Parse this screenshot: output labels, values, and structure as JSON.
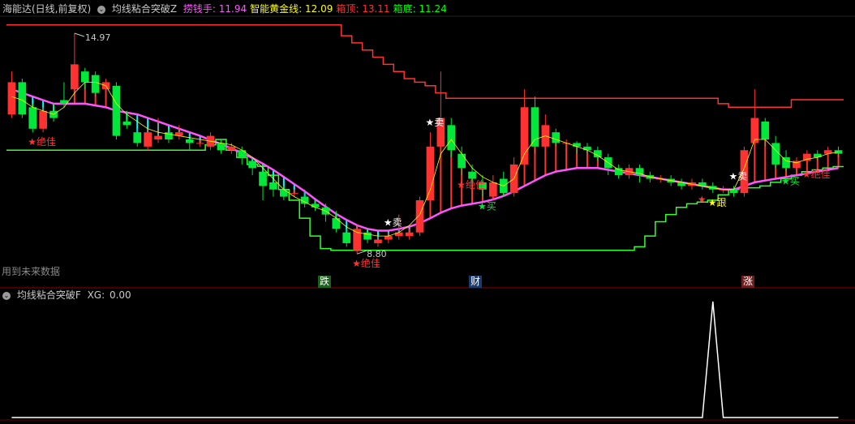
{
  "header": {
    "stock_title": "海能达(日线,前复权)",
    "indicator_name": "均线粘合突破Z",
    "items": [
      {
        "label": "捞钱手:",
        "value": "11.94",
        "color": "#ff55ff"
      },
      {
        "label": "智能黄金线:",
        "value": "12.09",
        "color": "#ffff00"
      },
      {
        "label": "箱顶:",
        "value": "13.11",
        "color": "#ff3333"
      },
      {
        "label": "箱底:",
        "value": "11.24",
        "color": "#00ff00"
      }
    ]
  },
  "future_note": "用到未来数据",
  "event_labels": [
    {
      "text": "跌",
      "bg": "#1f5f1f"
    },
    {
      "text": "财",
      "bg": "#1d3a6a"
    },
    {
      "text": "涨",
      "bg": "#6a1f1f"
    }
  ],
  "sub_header": {
    "indicator_name": "均线粘合突破F",
    "xg_label": "XG:",
    "xg_value": "0.00"
  },
  "chart_data": {
    "type": "candlestick",
    "price_high_label": "14.97",
    "price_low_label": "8.80",
    "colors": {
      "up": "#ff3232",
      "down": "#00e83a",
      "band": "#ff55ff",
      "fill": "#00ffff",
      "box_top": "#ff3333",
      "box_bottom": "#33ff33",
      "ma": "#ffff00"
    },
    "candles": [
      [
        12.7,
        13.6,
        13.9,
        12.6
      ],
      [
        13.6,
        12.7,
        13.7,
        12.6
      ],
      [
        12.9,
        12.3,
        13.0,
        12.2
      ],
      [
        12.3,
        12.8,
        12.9,
        12.2
      ],
      [
        12.8,
        12.6,
        13.0,
        12.5
      ],
      [
        13.1,
        13.0,
        13.6,
        12.9
      ],
      [
        13.4,
        14.1,
        14.97,
        13.3
      ],
      [
        13.9,
        13.6,
        14.0,
        13.4
      ],
      [
        13.8,
        13.3,
        13.9,
        13.2
      ],
      [
        13.4,
        13.6,
        13.7,
        13.2
      ],
      [
        13.5,
        12.1,
        13.6,
        12.0
      ],
      [
        12.5,
        12.4,
        12.8,
        12.3
      ],
      [
        12.2,
        11.9,
        12.3,
        11.8
      ],
      [
        11.8,
        12.2,
        12.3,
        11.7
      ],
      [
        12.0,
        12.1,
        12.6,
        11.9
      ],
      [
        12.2,
        12.0,
        12.3,
        11.9
      ],
      [
        12.1,
        12.2,
        12.4,
        12.0
      ],
      [
        12.0,
        11.9,
        12.1,
        11.7
      ],
      [
        11.9,
        11.9,
        12.0,
        11.8
      ],
      [
        11.8,
        12.1,
        12.2,
        11.7
      ],
      [
        11.9,
        11.7,
        12.0,
        11.6
      ],
      [
        11.7,
        11.8,
        11.9,
        11.6
      ],
      [
        11.7,
        11.5,
        11.8,
        11.3
      ],
      [
        11.4,
        11.2,
        11.5,
        11.0
      ],
      [
        11.1,
        10.7,
        11.3,
        10.3
      ],
      [
        10.8,
        10.6,
        10.9,
        10.4
      ],
      [
        10.6,
        10.4,
        10.7,
        10.3
      ],
      [
        10.5,
        10.5,
        10.6,
        10.4
      ],
      [
        10.4,
        10.2,
        10.6,
        10.1
      ],
      [
        10.2,
        10.1,
        10.3,
        10.0
      ],
      [
        10.1,
        9.9,
        10.2,
        9.7
      ],
      [
        9.8,
        9.5,
        10.0,
        9.4
      ],
      [
        9.4,
        9.1,
        9.5,
        9.0
      ],
      [
        8.9,
        9.5,
        9.6,
        8.8
      ],
      [
        9.4,
        9.2,
        9.5,
        9.1
      ],
      [
        9.1,
        9.2,
        9.3,
        9.0
      ],
      [
        9.2,
        9.3,
        9.4,
        9.1
      ],
      [
        9.3,
        9.4,
        9.9,
        9.2
      ],
      [
        9.3,
        9.4,
        9.5,
        9.2
      ],
      [
        9.4,
        10.3,
        10.4,
        9.3
      ],
      [
        10.3,
        11.8,
        12.2,
        10.2
      ],
      [
        11.8,
        12.6,
        13.9,
        11.6
      ],
      [
        12.4,
        11.7,
        12.6,
        11.5
      ],
      [
        11.6,
        11.2,
        11.8,
        11.0
      ],
      [
        11.1,
        10.9,
        11.3,
        10.7
      ],
      [
        10.8,
        10.6,
        11.0,
        10.4
      ],
      [
        10.4,
        10.8,
        11.0,
        10.3
      ],
      [
        10.9,
        10.5,
        11.1,
        10.4
      ],
      [
        10.5,
        11.3,
        11.5,
        10.4
      ],
      [
        11.3,
        12.9,
        13.4,
        11.2
      ],
      [
        12.9,
        11.8,
        13.2,
        11.6
      ],
      [
        11.8,
        12.4,
        12.7,
        11.7
      ],
      [
        12.2,
        11.9,
        12.3,
        11.8
      ],
      [
        11.9,
        11.9,
        12.0,
        11.7
      ],
      [
        11.9,
        11.8,
        11.95,
        11.6
      ],
      [
        11.8,
        11.7,
        11.9,
        11.6
      ],
      [
        11.7,
        11.5,
        11.8,
        11.4
      ],
      [
        11.5,
        11.2,
        11.6,
        11.0
      ],
      [
        11.2,
        11.0,
        11.3,
        10.9
      ],
      [
        11.0,
        11.2,
        11.3,
        10.9
      ],
      [
        11.2,
        11.0,
        11.3,
        10.8
      ],
      [
        11.0,
        10.9,
        11.1,
        10.8
      ],
      [
        10.9,
        10.9,
        11.0,
        10.8
      ],
      [
        10.9,
        10.8,
        11.0,
        10.7
      ],
      [
        10.8,
        10.7,
        10.9,
        10.6
      ],
      [
        10.7,
        10.8,
        10.9,
        10.6
      ],
      [
        10.8,
        10.7,
        10.9,
        10.6
      ],
      [
        10.7,
        10.6,
        10.8,
        10.5
      ],
      [
        10.6,
        10.6,
        10.7,
        10.5
      ],
      [
        10.6,
        10.5,
        10.7,
        10.4
      ],
      [
        10.5,
        11.7,
        11.8,
        10.4
      ],
      [
        11.9,
        12.6,
        13.4,
        11.8
      ],
      [
        12.5,
        12.0,
        12.6,
        11.8
      ],
      [
        11.9,
        11.3,
        12.1,
        11.2
      ],
      [
        11.5,
        11.2,
        11.7,
        11.1
      ],
      [
        11.2,
        11.4,
        11.5,
        11.1
      ],
      [
        11.4,
        11.6,
        11.7,
        11.3
      ],
      [
        11.6,
        11.5,
        11.7,
        11.4
      ],
      [
        11.6,
        11.7,
        11.8,
        11.5
      ],
      [
        11.7,
        11.6,
        11.8,
        11.5
      ]
    ],
    "band": [
      13.4,
      13.3,
      13.2,
      13.1,
      13.0,
      13.0,
      13.0,
      13.0,
      12.95,
      12.9,
      12.8,
      12.75,
      12.7,
      12.6,
      12.5,
      12.4,
      12.3,
      12.2,
      12.1,
      11.98,
      11.87,
      11.75,
      11.62,
      11.48,
      11.32,
      11.15,
      10.95,
      10.75,
      10.55,
      10.33,
      10.12,
      9.92,
      9.75,
      9.6,
      9.5,
      9.45,
      9.45,
      9.5,
      9.56,
      9.66,
      9.8,
      9.95,
      10.07,
      10.15,
      10.2,
      10.25,
      10.32,
      10.42,
      10.55,
      10.7,
      10.85,
      11.0,
      11.1,
      11.15,
      11.2,
      11.2,
      11.2,
      11.15,
      11.1,
      11.05,
      11.0,
      10.95,
      10.9,
      10.85,
      10.8,
      10.75,
      10.7,
      10.65,
      10.6,
      10.6,
      10.7,
      10.8,
      10.85,
      10.9,
      10.95,
      11.0,
      11.05,
      11.1,
      11.15,
      11.2
    ],
    "box_top": [
      15.2,
      15.2,
      15.2,
      15.2,
      15.2,
      15.2,
      15.2,
      15.2,
      15.2,
      15.2,
      15.2,
      15.2,
      15.2,
      15.2,
      15.2,
      15.2,
      15.2,
      15.2,
      15.2,
      15.2,
      15.2,
      15.2,
      15.2,
      15.2,
      15.2,
      15.2,
      15.2,
      15.2,
      15.2,
      15.2,
      15.2,
      15.2,
      14.9,
      14.7,
      14.5,
      14.3,
      14.1,
      13.9,
      13.7,
      13.6,
      13.5,
      13.3,
      13.15,
      13.15,
      13.15,
      13.15,
      13.15,
      13.15,
      13.15,
      13.15,
      13.15,
      13.15,
      13.15,
      13.15,
      13.15,
      13.15,
      13.15,
      13.15,
      13.15,
      13.15,
      13.15,
      13.15,
      13.15,
      13.15,
      13.15,
      13.15,
      13.15,
      13.15,
      13.0,
      12.9,
      12.9,
      12.9,
      12.9,
      12.9,
      12.9,
      13.11,
      13.11,
      13.11,
      13.11,
      13.11
    ],
    "box_bottom": [
      11.7,
      11.7,
      11.7,
      11.7,
      11.7,
      11.7,
      11.7,
      11.7,
      11.7,
      11.7,
      11.7,
      11.7,
      11.7,
      11.7,
      11.7,
      11.7,
      11.7,
      11.7,
      11.7,
      11.85,
      12.0,
      11.7,
      11.5,
      11.3,
      11.25,
      11.0,
      10.6,
      10.3,
      9.8,
      9.3,
      8.95,
      8.9,
      8.9,
      8.9,
      8.9,
      8.9,
      8.9,
      8.9,
      8.9,
      8.9,
      8.9,
      8.9,
      8.9,
      8.9,
      8.9,
      8.9,
      8.9,
      8.9,
      8.9,
      8.9,
      8.9,
      8.9,
      8.9,
      8.9,
      8.9,
      8.9,
      8.9,
      8.9,
      8.9,
      8.9,
      9.0,
      9.3,
      9.7,
      9.9,
      10.1,
      10.2,
      10.25,
      10.3,
      10.45,
      10.6,
      10.65,
      10.65,
      10.7,
      10.8,
      10.9,
      11.0,
      11.1,
      11.15,
      11.2,
      11.24
    ],
    "ma": [
      13.2,
      13.1,
      12.9,
      12.8,
      12.7,
      12.9,
      13.3,
      13.6,
      13.6,
      13.5,
      13.0,
      12.7,
      12.5,
      12.3,
      12.2,
      12.15,
      12.1,
      12.05,
      12.0,
      11.95,
      11.9,
      11.85,
      11.7,
      11.5,
      11.2,
      10.9,
      10.6,
      10.4,
      10.25,
      10.1,
      10.0,
      9.8,
      9.55,
      9.4,
      9.35,
      9.3,
      9.3,
      9.4,
      9.6,
      9.9,
      10.6,
      11.6,
      12.0,
      11.6,
      11.2,
      10.95,
      10.8,
      10.7,
      10.9,
      11.6,
      12.0,
      12.1,
      12.0,
      11.9,
      11.8,
      11.7,
      11.55,
      11.35,
      11.15,
      11.1,
      11.05,
      10.95,
      10.9,
      10.85,
      10.8,
      10.75,
      10.7,
      10.65,
      10.6,
      10.6,
      11.2,
      12.0,
      12.0,
      11.7,
      11.4,
      11.35,
      11.45,
      11.5,
      11.6,
      11.65
    ],
    "signals": [
      {
        "i": 2,
        "text": "★绝佳",
        "pos": "below",
        "color": "#ff3333"
      },
      {
        "i": 36,
        "text": "★卖",
        "pos": "above",
        "color": "#ffffff"
      },
      {
        "i": 40,
        "text": "★卖",
        "pos": "above",
        "color": "#ffffff"
      },
      {
        "i": 69,
        "text": "★卖",
        "pos": "above",
        "color": "#ffffff"
      },
      {
        "i": 43,
        "text": "★绝佳",
        "pos": "below",
        "color": "#ff3333"
      },
      {
        "i": 45,
        "text": "★买",
        "pos": "below",
        "color": "#00e83a"
      },
      {
        "i": 74,
        "text": "★买",
        "pos": "below",
        "color": "#00e83a"
      },
      {
        "i": 76,
        "text": "★绝佳",
        "pos": "below",
        "color": "#ff3333"
      },
      {
        "i": 33,
        "text": "★绝佳",
        "pos": "below",
        "color": "#ff3333"
      },
      {
        "i": 66,
        "text": "★",
        "pos": "below",
        "color": "#ff3333"
      },
      {
        "i": 67,
        "text": "★跟",
        "pos": "below",
        "color": "#ffff00"
      }
    ],
    "sub_values": [
      0,
      0,
      0,
      0,
      0,
      0,
      0,
      0,
      0,
      0,
      0,
      0,
      0,
      0,
      0,
      0,
      0,
      0,
      0,
      0,
      0,
      0,
      0,
      0,
      0,
      0,
      0,
      0,
      0,
      0,
      0,
      0,
      0,
      0,
      0,
      0,
      0,
      0,
      0,
      0,
      0,
      0,
      0,
      0,
      0,
      0,
      0,
      0,
      0,
      0,
      0,
      0,
      0,
      0,
      0,
      0,
      0,
      0,
      0,
      0,
      0,
      0,
      0,
      0,
      0,
      0,
      0,
      1,
      0,
      0,
      0,
      0,
      0,
      0,
      0,
      0,
      0,
      0,
      0,
      0
    ]
  }
}
